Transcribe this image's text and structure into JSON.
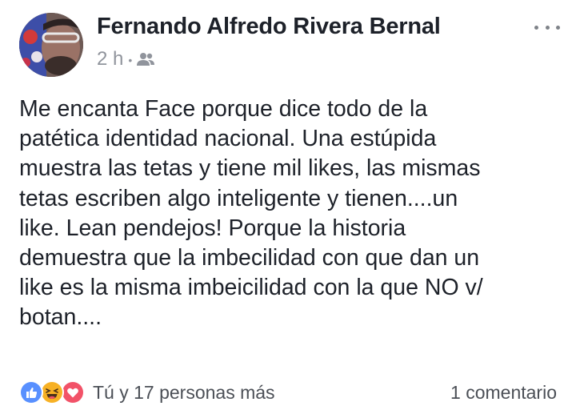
{
  "post": {
    "author": "Fernando Alfredo Rivera Bernal",
    "timestamp": "2 h",
    "separator": "•",
    "privacy_icon": "friends-icon",
    "more_icon": "more-options-icon",
    "text_lines": [
      "Me encanta Face porque dice todo de la",
      "patética identidad nacional. Una estúpida",
      "muestra las tetas y tiene mil likes, las mismas",
      "tetas escriben algo inteligente y tienen....un",
      "like. Lean pendejos! Porque la historia",
      "demuestra que la imbecilidad con que dan un",
      "like es la misma imbeicilidad con la que NO v/",
      "botan...."
    ],
    "reactions": {
      "icons": [
        "like-icon",
        "haha-icon",
        "love-icon"
      ],
      "colors": {
        "like": "#5890ff",
        "haha": "#f7b125",
        "love": "#f25268"
      },
      "summary": "Tú y 17 personas más"
    },
    "comments": "1 comentario"
  }
}
